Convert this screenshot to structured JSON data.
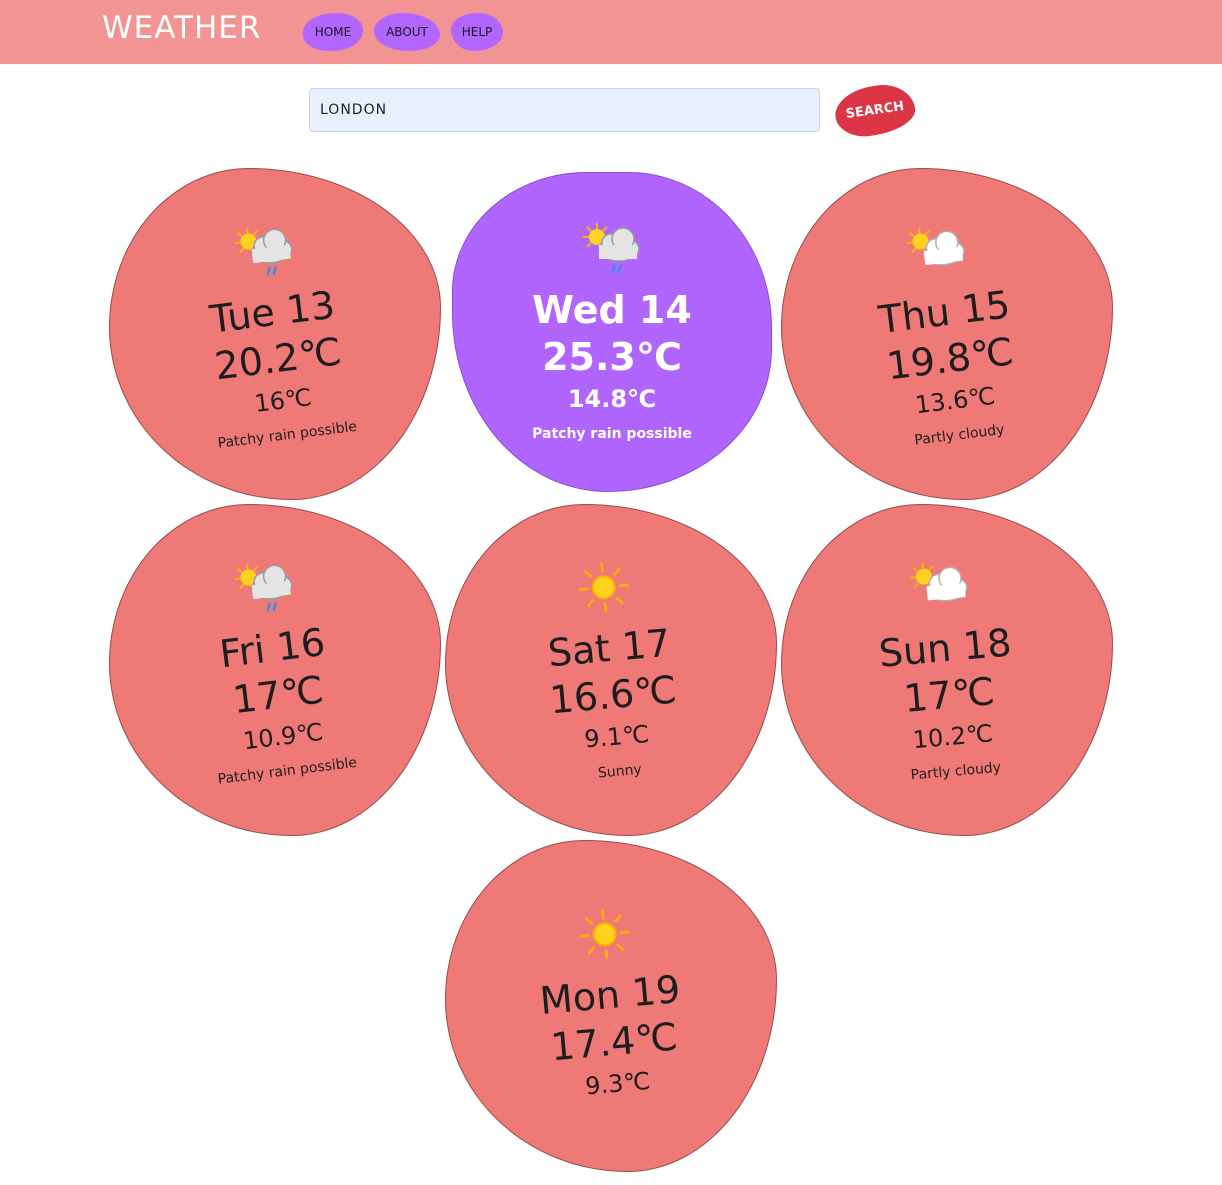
{
  "header": {
    "brand": "WEATHER",
    "nav": [
      "HOME",
      "ABOUT",
      "HELP"
    ]
  },
  "search": {
    "value": "LONDON",
    "button": "SEARCH"
  },
  "colors": {
    "header_bg": "#f19493",
    "card_bg": "#ef7977",
    "card_active_bg": "#b066fe",
    "nav_bg": "#b266ff",
    "search_btn_bg": "#dc3545"
  },
  "forecast": [
    {
      "day": "Tue 13",
      "high": "20.2℃",
      "low": "16℃",
      "desc": "Patchy rain possible",
      "icon": "sun-cloud-rain-icon"
    },
    {
      "day": "Wed 14",
      "high": "25.3℃",
      "low": "14.8℃",
      "desc": "Patchy rain possible",
      "icon": "sun-cloud-rain-icon"
    },
    {
      "day": "Thu 15",
      "high": "19.8℃",
      "low": "13.6℃",
      "desc": "Partly cloudy",
      "icon": "sun-cloud-icon"
    },
    {
      "day": "Fri 16",
      "high": "17℃",
      "low": "10.9℃",
      "desc": "Patchy rain possible",
      "icon": "sun-cloud-rain-icon"
    },
    {
      "day": "Sat 17",
      "high": "16.6℃",
      "low": "9.1℃",
      "desc": "Sunny",
      "icon": "sun-icon"
    },
    {
      "day": "Sun 18",
      "high": "17℃",
      "low": "10.2℃",
      "desc": "Partly cloudy",
      "icon": "sun-cloud-icon"
    },
    {
      "day": "Mon 19",
      "high": "17.4℃",
      "low": "9.3℃",
      "desc": "",
      "icon": "sun-icon"
    }
  ]
}
